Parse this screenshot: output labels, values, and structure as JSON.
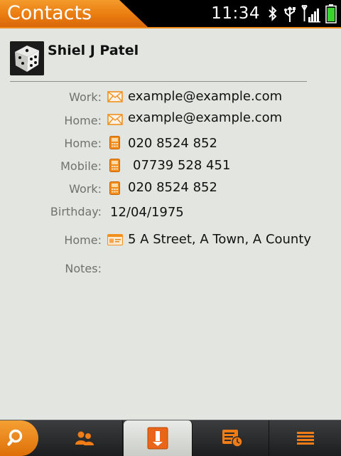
{
  "app": {
    "title": "Contacts"
  },
  "status_bar": {
    "time": "11:34"
  },
  "contact": {
    "name": "Shiel J Patel"
  },
  "fields": {
    "email_work": {
      "label": "Work:",
      "value": "example@example.com",
      "icon": "mail-icon"
    },
    "email_home": {
      "label": "Home:",
      "value": "example@example.com",
      "icon": "mail-icon"
    },
    "phone_home": {
      "label": "Home:",
      "value": "020 8524 852",
      "icon": "phone-icon"
    },
    "phone_mobile": {
      "label": "Mobile:",
      "value": "07739 528 451",
      "icon": "phone-icon"
    },
    "phone_work": {
      "label": "Work:",
      "value": "020 8524 852",
      "icon": "phone-icon"
    },
    "birthday": {
      "label": "Birthday:",
      "value": "12/04/1975"
    },
    "address_home": {
      "label": "Home:",
      "value": "5 A Street, A Town, A County",
      "icon": "address-card-icon"
    },
    "notes": {
      "label": "Notes:",
      "value": ""
    }
  },
  "toolbar": {
    "tabs": [
      "search-icon",
      "contacts-icon",
      "contact-details-icon",
      "history-icon",
      "menu-icon"
    ],
    "selected": "contact-details-icon"
  },
  "colors": {
    "accent": "#f08a1a",
    "background": "#e3e5e1"
  }
}
